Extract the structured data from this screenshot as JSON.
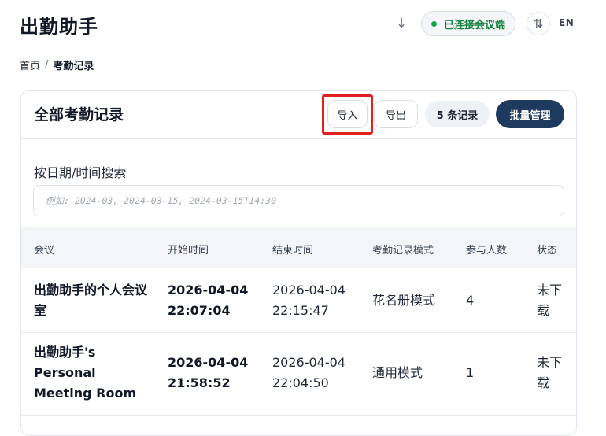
{
  "header": {
    "app_title": "出勤助手",
    "download_icon": "download-arrow-icon",
    "status_text": "已连接会议端",
    "status_color": "#16a34a",
    "sync_icon": "swap-vertical-icon",
    "lang_label": "EN"
  },
  "breadcrumb": {
    "home": "首页",
    "separator": "/",
    "current": "考勤记录"
  },
  "card": {
    "title": "全部考勤记录",
    "import_label": "导入",
    "export_label": "导出",
    "count_label": "5 条记录",
    "batch_label": "批量管理",
    "accent_color": "#1e3a5f",
    "highlight_color": "#e02020"
  },
  "search": {
    "label": "按日期/时间搜索",
    "placeholder": "例如: 2024-03, 2024-03-15, 2024-03-15T14:30",
    "value": ""
  },
  "table": {
    "columns": [
      "会议",
      "开始时间",
      "结束时间",
      "考勤记录模式",
      "参与人数",
      "状态"
    ],
    "rows": [
      {
        "meeting": "出勤助手的个人会议室",
        "start": "2026-04-04 22:07:04",
        "end": "2026-04-04 22:15:47",
        "mode": "花名册模式",
        "participants": "4",
        "status": "未下载"
      },
      {
        "meeting": "出勤助手's Personal Meeting Room",
        "start": "2026-04-04 21:58:52",
        "end": "2026-04-04 22:04:50",
        "mode": "通用模式",
        "participants": "1",
        "status": "未下载"
      }
    ]
  }
}
